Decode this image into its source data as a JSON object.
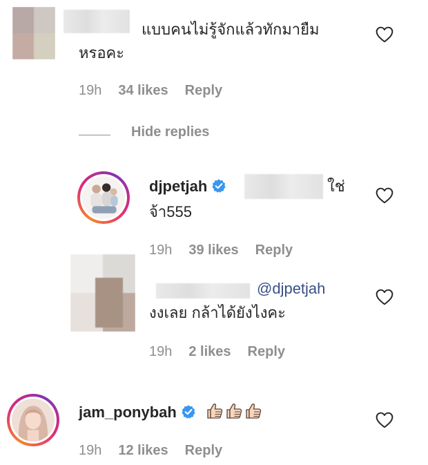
{
  "comments": [
    {
      "text_line1": "แบบคนไม่รู้จักแล้วทักมายืม",
      "text_line2": "หรอคะ",
      "time": "19h",
      "likes": "34 likes",
      "reply": "Reply"
    }
  ],
  "hide_replies": "Hide replies",
  "replies": [
    {
      "username": "djpetjah",
      "text_tail": "ใช่",
      "text_line2": "จ้า555",
      "time": "19h",
      "likes": "39 likes",
      "reply": "Reply"
    },
    {
      "mention": "@djpetjah",
      "text_line2": "งงเลย กล้าได้ยังไงคะ",
      "time": "19h",
      "likes": "2 likes",
      "reply": "Reply"
    }
  ],
  "bottom_comment": {
    "username": "jam_ponybah",
    "time": "19h",
    "likes": "12 likes",
    "reply": "Reply"
  },
  "icons": {
    "heart": "heart-outline-icon",
    "verified": "verified-badge-icon",
    "thumbs": "thumbs-up-emoji"
  },
  "colors": {
    "text": "#262626",
    "meta": "#8e8e8e",
    "mention": "#385185",
    "verified": "#3897f0"
  }
}
